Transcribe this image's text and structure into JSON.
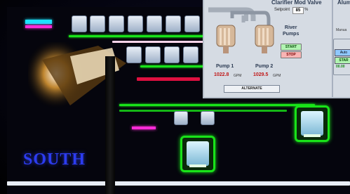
{
  "background": {
    "site_label": "SOUTH"
  },
  "inset": {
    "valve_title": "Clarifier Mod Valve",
    "setpoint_label": "Setpoint",
    "setpoint_value": "85",
    "setpoint_unit": "%",
    "river_pumps_line1": "River",
    "river_pumps_line2": "Pumps",
    "start_label": "START",
    "stop_label": "STOP",
    "pump1": {
      "label": "Pump 1",
      "value": "1022.8",
      "unit": "GPM"
    },
    "pump2": {
      "label": "Pump 2",
      "value": "1029.5",
      "unit": "GPM"
    },
    "alternate_label": "ALTERNATE",
    "alum_title": "Alum",
    "manual_label": "Manua",
    "auto_label": "Auto",
    "start2_label": "STAR",
    "small_value": "00.00"
  },
  "colors": {
    "green": "#19e319",
    "magenta": "#ff2bd8",
    "cyan": "#1ae4ff",
    "red": "#e01040",
    "blue_text": "#2c3cf0"
  }
}
